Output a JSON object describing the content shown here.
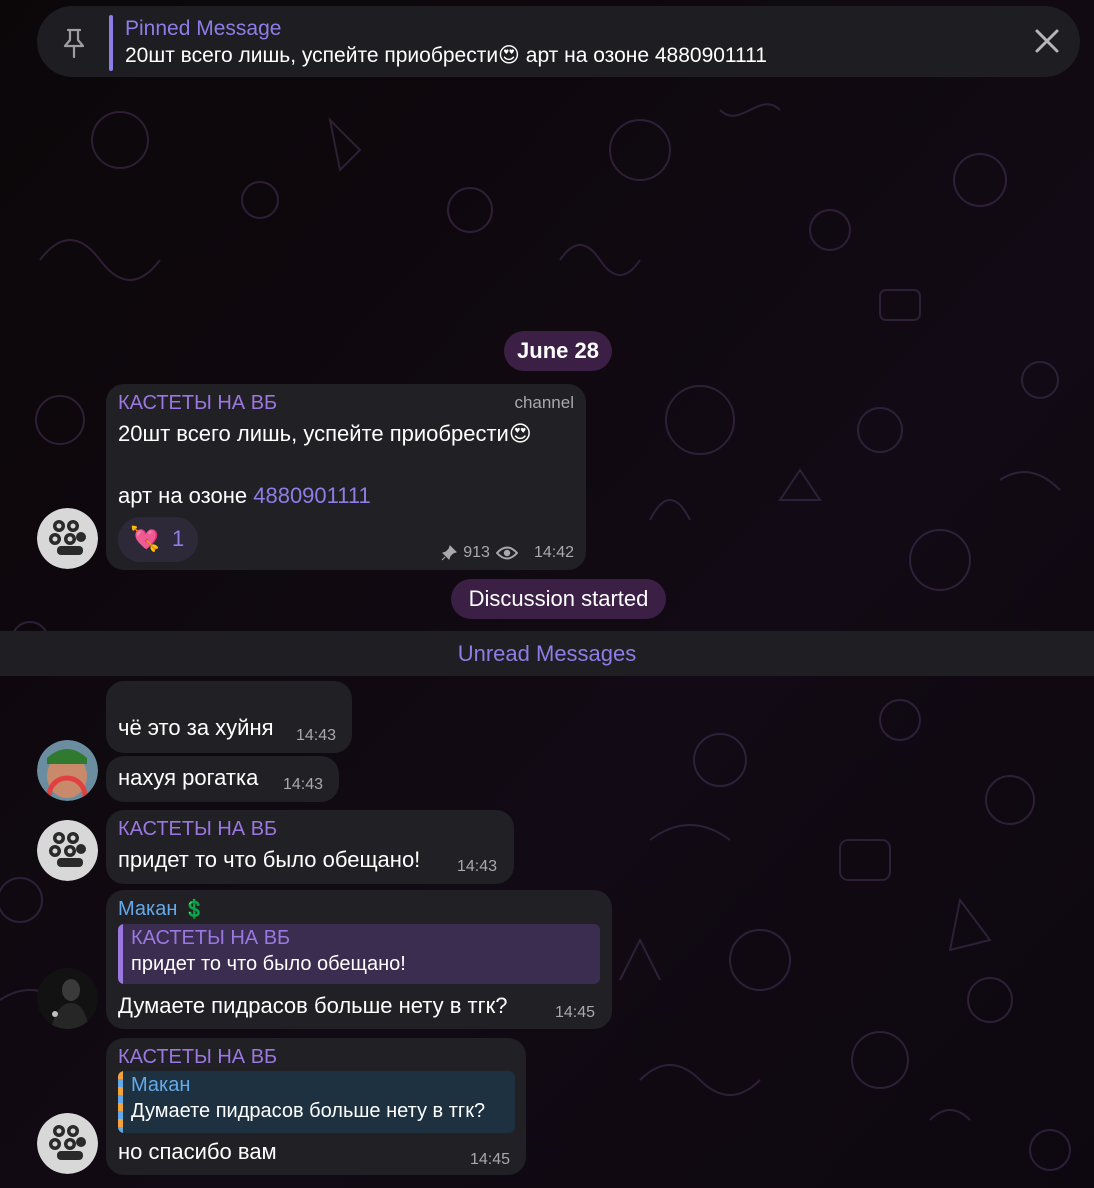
{
  "pinned": {
    "title": "Pinned Message",
    "text": "20шт всего лишь, успейте приобрести😍 арт на озоне 4880901111"
  },
  "date_label": "June 28",
  "channel_post": {
    "author": "КАСТЕТЫ НА ВБ",
    "badge": "channel",
    "line1": "20шт всего лишь, успейте приобрести😍",
    "line2_prefix": "арт на озоне ",
    "line2_link": "4880901111",
    "reaction_emoji": "💘",
    "reaction_count": "1",
    "views": "913",
    "time": "14:42"
  },
  "discussion_label": "Discussion started",
  "unread_label": "Unread Messages",
  "messages": [
    {
      "text": "чё это за хуйня",
      "time": "14:43"
    },
    {
      "text": "нахуя рогатка",
      "time": "14:43"
    },
    {
      "author": "КАСТЕТЫ НА ВБ",
      "text": "придет то что было обещано!",
      "time": "14:43"
    },
    {
      "author": "Макан",
      "author_badge": "💲",
      "reply_author": "КАСТЕТЫ НА ВБ",
      "reply_text": "придет то что было обещано!",
      "text": "Думаете пидрасов больше нету в тгк?",
      "time": "14:45"
    },
    {
      "author": "КАСТЕТЫ НА ВБ",
      "reply_author": "Макан",
      "reply_text": "Думаете пидрасов больше нету в тгк?",
      "text": "но спасибо вам",
      "time": "14:45"
    }
  ],
  "colors": {
    "accent": "#8c7ee6",
    "channel_name": "#9a78e0",
    "user_name": "#64aaeb",
    "bubble": "#212024",
    "pill": "#3b1f45"
  }
}
